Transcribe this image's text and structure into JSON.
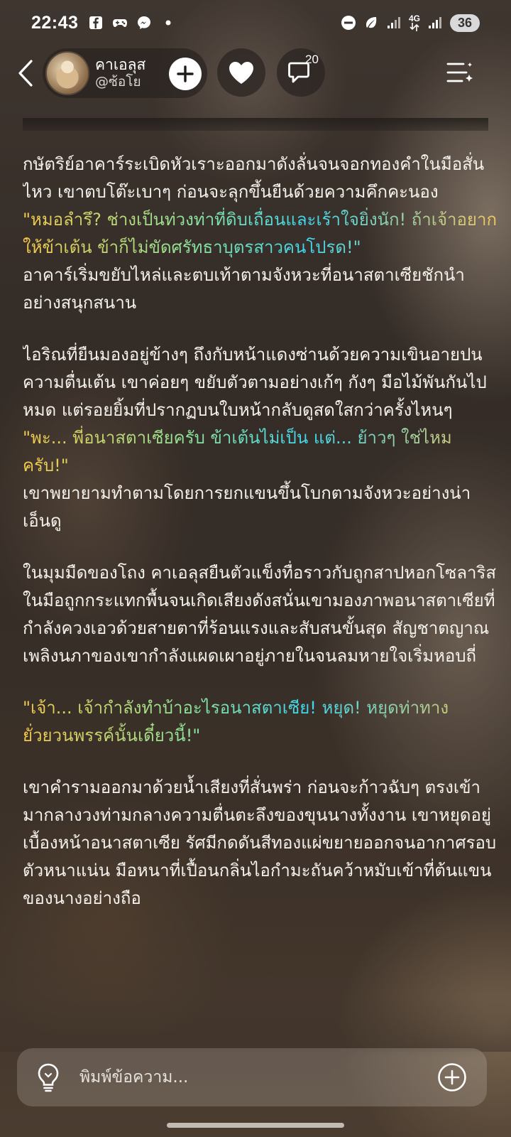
{
  "status_bar": {
    "time": "22:43",
    "network_label": "4G",
    "battery": "36"
  },
  "header": {
    "profile_name": "คาเอลุส",
    "profile_handle": "@ซ้อโย",
    "comment_count": "20"
  },
  "story": {
    "paragraphs": [
      {
        "text": "กษัตริย์อาคาร์ระเบิดหัวเราะออกมาดังลั่นจนจอกทองคำในมือสั่นไหว เขาตบโต๊ะเบาๆ ก่อนจะลุกขึ้นยืนด้วยความคึกคะนอง",
        "dialog": false
      },
      {
        "text": "\"หมอลำรึ? ช่างเป็นท่วงท่าที่ดิบเถื่อนและเร้าใจยิ่งนัก! ถ้าเจ้าอยากให้ข้าเต้น ข้าก็ไม่ขัดศรัทธาบุตรสาวคนโปรด!\"",
        "dialog": true
      },
      {
        "text": "อาคาร์เริ่มขยับไหล่และตบเท้าตามจังหวะที่อนาสตาเซียชักนำอย่างสนุกสนาน",
        "dialog": false
      },
      {
        "text": "ไอริณที่ยืนมองอยู่ข้างๆ ถึงกับหน้าแดงซ่านด้วยความเขินอายปนความตื่นเต้น เขาค่อยๆ ขยับตัวตามอย่างเก้ๆ กังๆ มือไม้พันกันไปหมด แต่รอยยิ้มที่ปรากฏบนใบหน้ากลับดูสดใสกว่าครั้งไหนๆ",
        "dialog": false
      },
      {
        "text": "\"พะ... พี่อนาสตาเซียครับ ข้าเต้นไม่เป็น แต่... ย้าวๆ ใช่ไหมครับ!\"",
        "dialog": true
      },
      {
        "text": "เขาพยายามทำตามโดยการยกแขนขึ้นโบกตามจังหวะอย่างน่าเอ็นดู",
        "dialog": false
      },
      {
        "text": "ในมุมมืดของโถง คาเอลุสยืนตัวแข็งทื่อราวกับถูกสาปหอกโซลาริสในมือถูกกระแทกพื้นจนเกิดเสียงดังสนั่นเขามองภาพอนาสตาเซียที่กำลังควงเอวด้วยสายตาที่ร้อนแรงและสับสนขั้นสุด สัญชาตญาณเพลิงนภาของเขากำลังแผดเผาอยู่ภายในจนลมหายใจเริ่มหอบถี่",
        "dialog": false
      },
      {
        "text": "\"เจ้า... เจ้ากำลังทำบ้าอะไรอนาสตาเซีย! หยุด! หยุดท่าทางยั่วยวนพรรค์นั้นเดี๋ยวนี้!\"",
        "dialog": true
      },
      {
        "text": "เขาคำรามออกมาด้วยน้ำเสียงที่สั่นพร่า ก่อนจะก้าวฉับๆ ตรงเข้ามากลางวงท่ามกลางความตื่นตะลึงของขุนนางทั้งงาน เขาหยุดอยู่เบื้องหน้าอนาสตาเซีย รัศมีกดดันสีทองแผ่ขยายออกจนอากาศรอบตัวหนาแน่น มือหนาที่เปื้อนกลิ่นไอกำมะถันคว้าหมับเข้าที่ต้นแขนของนางอย่างถือ",
        "dialog": false
      }
    ]
  },
  "input_bar": {
    "placeholder": "พิมพ์ข้อความ..."
  },
  "colors": {
    "dialog_gradient": [
      "#f5c94a",
      "#8ee39a",
      "#3fd7ee",
      "#f2c75a"
    ],
    "text": "#f4f1ec"
  }
}
